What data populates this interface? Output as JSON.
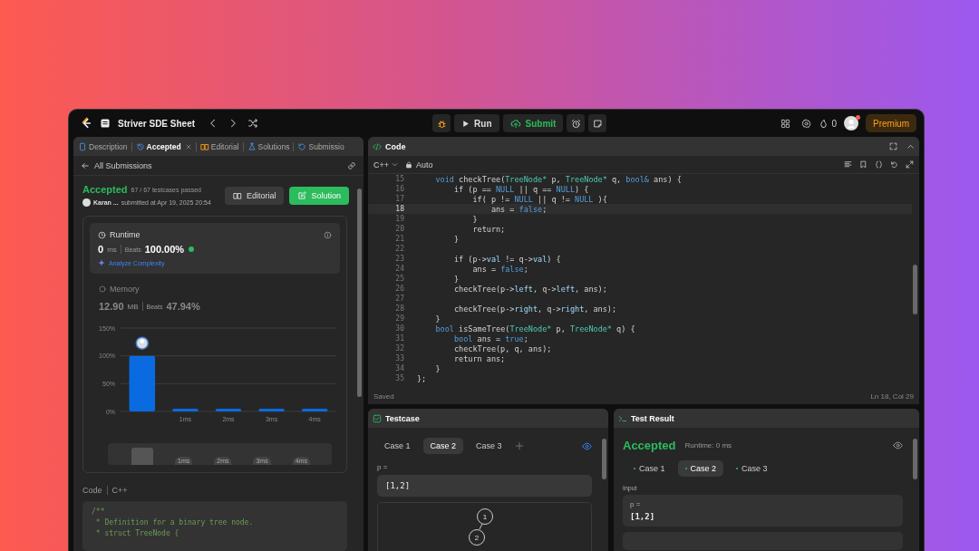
{
  "topbar": {
    "list_title": "Striver SDE Sheet",
    "run": "Run",
    "submit": "Submit",
    "streak": "0",
    "premium": "Premium"
  },
  "left_tabs": [
    {
      "label": "Description",
      "selected": false,
      "closable": false
    },
    {
      "label": "Accepted",
      "selected": true,
      "closable": true
    },
    {
      "label": "Editorial",
      "selected": false,
      "closable": false
    },
    {
      "label": "Solutions",
      "selected": false,
      "closable": false
    },
    {
      "label": "Submissio",
      "selected": false,
      "closable": false
    }
  ],
  "submission": {
    "back": "All Submissions",
    "status": "Accepted",
    "passed": "67 / 67 testcases passed",
    "author": "Karan ...",
    "submitted": "submitted at Apr 19, 2025 20:54",
    "editorial": "Editorial",
    "solution": "Solution"
  },
  "runtime": {
    "title": "Runtime",
    "value": "0",
    "unit": "ms",
    "beats_label": "Beats",
    "beats": "100.00%",
    "analyze": "Analyze Complexity"
  },
  "memory": {
    "title": "Memory",
    "value": "12.90",
    "unit": "MB",
    "beats_label": "Beats",
    "beats": "47.94%"
  },
  "chart_data": {
    "type": "bar",
    "categories": [
      null,
      "1ms",
      "2ms",
      "3ms",
      "4ms"
    ],
    "values": [
      100,
      3,
      3,
      3,
      3
    ],
    "ylim": [
      0,
      150
    ],
    "yticks": [
      {
        "value": 0,
        "label": "0%"
      },
      {
        "value": 50,
        "label": "50%"
      },
      {
        "value": 100,
        "label": "100%"
      },
      {
        "value": 150,
        "label": "150%"
      }
    ]
  },
  "navigator_labels": [
    "1ms",
    "2ms",
    "3ms",
    "4ms"
  ],
  "code_preview": {
    "label": "Code",
    "language": "C++",
    "lines": [
      "/**",
      " * Definition for a binary tree node.",
      " * struct TreeNode {"
    ]
  },
  "editor": {
    "title": "Code",
    "language": "C++",
    "mode": "Auto",
    "status": "Saved",
    "cursor": "Ln 18, Col 29",
    "lines": [
      {
        "number": "15",
        "active": false,
        "tokens": [
          {
            "text": "    void",
            "kind": "kw"
          },
          {
            "text": " checkTree(",
            "kind": "p"
          },
          {
            "text": "TreeNode*",
            "kind": "type"
          },
          {
            "text": " p, ",
            "kind": "p"
          },
          {
            "text": "TreeNode*",
            "kind": "type"
          },
          {
            "text": " q, ",
            "kind": "p"
          },
          {
            "text": "bool&",
            "kind": "kw"
          },
          {
            "text": " ans) {",
            "kind": "p"
          }
        ]
      },
      {
        "number": "16",
        "active": false,
        "tokens": [
          {
            "text": "        if (p == ",
            "kind": "p"
          },
          {
            "text": "NULL",
            "kind": "kw"
          },
          {
            "text": " || q == ",
            "kind": "p"
          },
          {
            "text": "NULL",
            "kind": "kw"
          },
          {
            "text": ") {",
            "kind": "p"
          }
        ]
      },
      {
        "number": "17",
        "active": false,
        "tokens": [
          {
            "text": "            if( p != ",
            "kind": "p"
          },
          {
            "text": "NULL",
            "kind": "kw"
          },
          {
            "text": " || q != ",
            "kind": "p"
          },
          {
            "text": "NULL",
            "kind": "kw"
          },
          {
            "text": " ){",
            "kind": "p"
          }
        ]
      },
      {
        "number": "18",
        "active": true,
        "tokens": [
          {
            "text": "                ans = ",
            "kind": "p"
          },
          {
            "text": "false",
            "kind": "kw"
          },
          {
            "text": ";",
            "kind": "p"
          }
        ]
      },
      {
        "number": "19",
        "active": false,
        "tokens": [
          {
            "text": "            }",
            "kind": "p"
          }
        ]
      },
      {
        "number": "20",
        "active": false,
        "tokens": [
          {
            "text": "            return;",
            "kind": "p"
          }
        ]
      },
      {
        "number": "21",
        "active": false,
        "tokens": [
          {
            "text": "        }",
            "kind": "p"
          }
        ]
      },
      {
        "number": "22",
        "active": false
      },
      {
        "number": "23",
        "active": false,
        "tokens": [
          {
            "text": "        if (p->",
            "kind": "p"
          },
          {
            "text": "val",
            "kind": "prop"
          },
          {
            "text": " != q->",
            "kind": "p"
          },
          {
            "text": "val",
            "kind": "prop"
          },
          {
            "text": ") {",
            "kind": "p"
          }
        ]
      },
      {
        "number": "24",
        "active": false,
        "tokens": [
          {
            "text": "            ans = ",
            "kind": "p"
          },
          {
            "text": "false",
            "kind": "kw"
          },
          {
            "text": ";",
            "kind": "p"
          }
        ]
      },
      {
        "number": "25",
        "active": false,
        "tokens": [
          {
            "text": "        }",
            "kind": "p"
          }
        ]
      },
      {
        "number": "26",
        "active": false,
        "tokens": [
          {
            "text": "        checkTree(p->",
            "kind": "p"
          },
          {
            "text": "left",
            "kind": "prop"
          },
          {
            "text": ", q->",
            "kind": "p"
          },
          {
            "text": "left",
            "kind": "prop"
          },
          {
            "text": ", ans);",
            "kind": "p"
          }
        ]
      },
      {
        "number": "27",
        "active": false
      },
      {
        "number": "28",
        "active": false,
        "tokens": [
          {
            "text": "        checkTree(p->",
            "kind": "p"
          },
          {
            "text": "right",
            "kind": "prop"
          },
          {
            "text": ", q->",
            "kind": "p"
          },
          {
            "text": "right",
            "kind": "prop"
          },
          {
            "text": ", ans);",
            "kind": "p"
          }
        ]
      },
      {
        "number": "29",
        "active": false,
        "tokens": [
          {
            "text": "    }",
            "kind": "p"
          }
        ]
      },
      {
        "number": "30",
        "active": false,
        "tokens": [
          {
            "text": "    bool",
            "kind": "kw"
          },
          {
            "text": " isSameTree(",
            "kind": "p"
          },
          {
            "text": "TreeNode*",
            "kind": "type"
          },
          {
            "text": " p, ",
            "kind": "p"
          },
          {
            "text": "TreeNode*",
            "kind": "type"
          },
          {
            "text": " q) {",
            "kind": "p"
          }
        ]
      },
      {
        "number": "31",
        "active": false,
        "tokens": [
          {
            "text": "        bool",
            "kind": "kw"
          },
          {
            "text": " ans = ",
            "kind": "p"
          },
          {
            "text": "true",
            "kind": "kw"
          },
          {
            "text": ";",
            "kind": "p"
          }
        ]
      },
      {
        "number": "32",
        "active": false,
        "tokens": [
          {
            "text": "        checkTree(p, q, ans);",
            "kind": "p"
          }
        ]
      },
      {
        "number": "33",
        "active": false,
        "tokens": [
          {
            "text": "        return ans;",
            "kind": "p"
          }
        ]
      },
      {
        "number": "34",
        "active": false,
        "tokens": [
          {
            "text": "    }",
            "kind": "p"
          }
        ]
      },
      {
        "number": "35",
        "active": false,
        "tokens": [
          {
            "text": "};",
            "kind": "p"
          }
        ]
      }
    ]
  },
  "testcase": {
    "title": "Testcase",
    "cases": [
      {
        "label": "Case 1",
        "selected": false
      },
      {
        "label": "Case 2",
        "selected": true
      },
      {
        "label": "Case 3",
        "selected": false
      }
    ],
    "param": "p =",
    "value": "[1,2]",
    "tree": [
      "1",
      "2"
    ]
  },
  "result": {
    "title": "Test Result",
    "status": "Accepted",
    "runtime": "Runtime: 0 ms",
    "cases": [
      {
        "label": "Case 1",
        "selected": false
      },
      {
        "label": "Case 2",
        "selected": true
      },
      {
        "label": "Case 3",
        "selected": false
      }
    ],
    "input_label": "Input",
    "param": "p =",
    "value": "[1,2]"
  }
}
